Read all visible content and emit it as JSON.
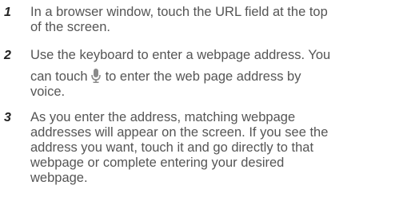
{
  "steps": [
    {
      "number": "1",
      "lines": [
        "In a browser window, touch the URL field at the top",
        "of the screen."
      ]
    },
    {
      "number": "2",
      "line1": "Use the keyboard to enter a webpage address. You",
      "line2_before_icon": "can touch",
      "icon": "microphone-icon",
      "line2_after_icon": "to enter the web page address by",
      "line3": "voice."
    },
    {
      "number": "3",
      "lines": [
        "As you enter the address, matching webpage",
        "addresses will appear on the screen. If you see the",
        "address you want, touch it and go directly to that",
        "webpage or complete entering your desired",
        "webpage."
      ]
    }
  ]
}
